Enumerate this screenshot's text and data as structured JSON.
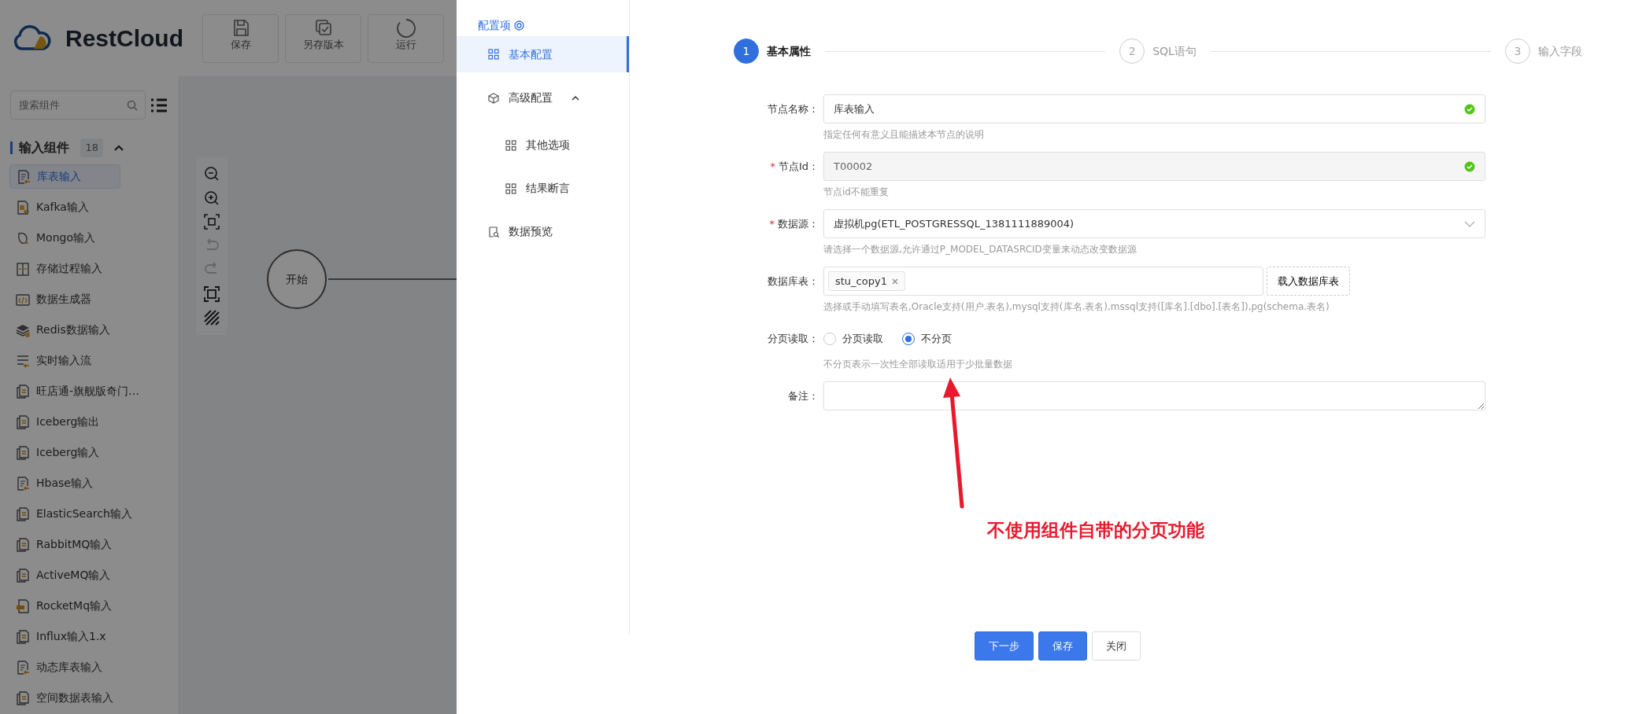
{
  "app": {
    "logo": "RestCloud",
    "toolbar": [
      {
        "label": "保存",
        "kind": "save"
      },
      {
        "label": "另存版本",
        "kind": "save-as"
      },
      {
        "label": "运行",
        "kind": "run"
      }
    ],
    "sidebar": {
      "search": {
        "placeholder": "搜索组件"
      },
      "group": {
        "title": "输入组件",
        "count": "18",
        "expanded": true
      },
      "items": [
        {
          "label": "库表输入",
          "kind": "doc-arrow",
          "selected": true
        },
        {
          "label": "Kafka输入",
          "kind": "kafka",
          "selected": false
        },
        {
          "label": "Mongo输入",
          "kind": "leaf",
          "selected": false
        },
        {
          "label": "存储过程输入",
          "kind": "columns",
          "selected": false
        },
        {
          "label": "数据生成器",
          "kind": "code",
          "selected": false
        },
        {
          "label": "Redis数据输入",
          "kind": "stack",
          "selected": false
        },
        {
          "label": "实时输入流",
          "kind": "lines",
          "selected": false
        },
        {
          "label": "旺店通-旗舰版奇门…",
          "kind": "doc",
          "selected": false
        },
        {
          "label": "Iceberg输出",
          "kind": "doc",
          "selected": false
        },
        {
          "label": "Iceberg输入",
          "kind": "doc",
          "selected": false
        },
        {
          "label": "Hbase输入",
          "kind": "doc-arrow",
          "selected": false
        },
        {
          "label": "ElasticSearch输入",
          "kind": "doc",
          "selected": false
        },
        {
          "label": "RabbitMQ输入",
          "kind": "doc",
          "selected": false
        },
        {
          "label": "ActiveMQ输入",
          "kind": "doc",
          "selected": false
        },
        {
          "label": "RocketMq输入",
          "kind": "rocket",
          "selected": false
        },
        {
          "label": "Influx输入1.x",
          "kind": "doc",
          "selected": false
        },
        {
          "label": "动态库表输入",
          "kind": "doc-arrow",
          "selected": false
        },
        {
          "label": "空间数据表输入",
          "kind": "doc",
          "selected": false
        }
      ]
    },
    "canvas": {
      "tools": [
        {
          "kind": "zoom-out",
          "disabled": false
        },
        {
          "kind": "zoom-in",
          "disabled": false
        },
        {
          "kind": "fit",
          "disabled": false
        },
        {
          "kind": "undo",
          "disabled": true
        },
        {
          "kind": "redo",
          "disabled": true
        },
        {
          "kind": "fullscreen",
          "disabled": false
        },
        {
          "kind": "hatch",
          "disabled": false
        }
      ],
      "nodes": [
        {
          "label": "开始"
        }
      ]
    }
  },
  "drawer": {
    "nav_title": "配置项",
    "nav": [
      {
        "label": "基本配置",
        "kind": "link",
        "selected": true
      },
      {
        "label": "高级配置",
        "kind": "group",
        "expanded": true,
        "children": [
          {
            "label": "其他选项",
            "selected": false
          },
          {
            "label": "结果断言",
            "selected": false
          }
        ]
      },
      {
        "label": "数据预览",
        "kind": "preview",
        "selected": false
      }
    ],
    "steps": [
      {
        "number": "1",
        "label": "基本属性",
        "selected": true
      },
      {
        "number": "2",
        "label": "SQL语句",
        "selected": false
      },
      {
        "number": "3",
        "label": "输入字段",
        "selected": false
      }
    ],
    "form": [
      {
        "kind": "text",
        "label": "节点名称：",
        "value": "库表输入",
        "disabled": false,
        "valid": true,
        "help": "指定任何有意义且能描述本节点的说明"
      },
      {
        "kind": "text",
        "label": "节点Id：",
        "required_mark": "*",
        "value": "T00002",
        "disabled": true,
        "valid": true,
        "help": "节点id不能重复"
      },
      {
        "kind": "select",
        "label": "数据源：",
        "required_mark": "*",
        "value": "虚拟机pg(ETL_POSTGRESSQL_1381111889004)",
        "help": "请选择一个数据源,允许通过P_MODEL_DATASRCID变量来动态改变数据源"
      },
      {
        "kind": "tags",
        "label": "数据库表：",
        "tags": [
          "stu_copy1"
        ],
        "button": "载入数据库表",
        "help": "选择或手动填写表名,Oracle支持(用户.表名),mysql支持(库名.表名),mssql支持([库名].[dbo].[表名]),pg(schema.表名)"
      },
      {
        "kind": "radio",
        "label": "分页读取：",
        "options": [
          {
            "label": "分页读取",
            "selected": false
          },
          {
            "label": "不分页",
            "selected": true
          }
        ],
        "help": "不分页表示一次性全部读取适用于少批量数据"
      },
      {
        "kind": "textarea",
        "label": "备注："
      }
    ],
    "buttons": [
      {
        "label": "下一步",
        "kind": "primary"
      },
      {
        "label": "保存",
        "kind": "primary"
      },
      {
        "label": "关闭",
        "kind": "default"
      }
    ],
    "annotation": {
      "text": "不使用组件自带的分页功能"
    }
  }
}
